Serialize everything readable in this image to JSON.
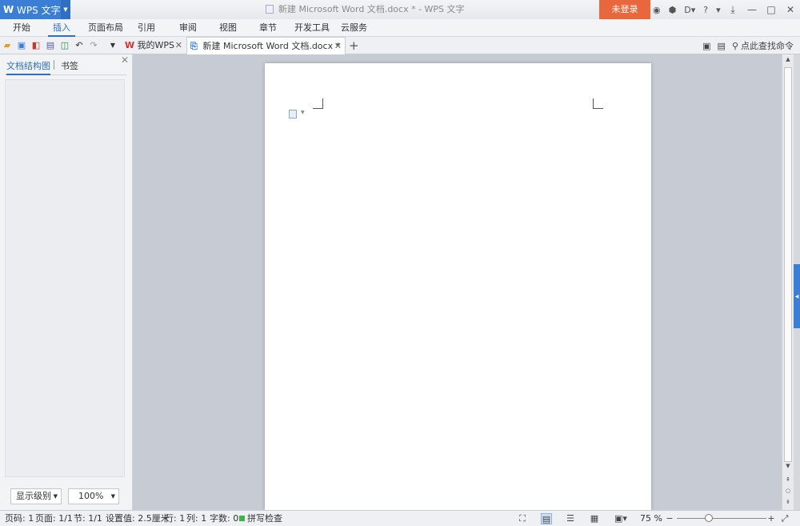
{
  "titlebar": {
    "app_name": "WPS 文字",
    "app_logo": "W",
    "document_title": "新建 Microsoft Word 文档.docx * - WPS 文字",
    "login_label": "未登录",
    "help_label": "?"
  },
  "menu": {
    "items": [
      "开始",
      "插入",
      "页面布局",
      "引用",
      "审阅",
      "视图",
      "章节",
      "开发工具",
      "云服务"
    ],
    "active": "插入"
  },
  "tabs": [
    {
      "label": "我的WPS",
      "icon": "wps-logo-icon"
    },
    {
      "label": "新建 Microsoft Word 文档.docx *",
      "icon": "document-icon",
      "active": true
    }
  ],
  "toolbar": {
    "search_command_label": "点此查找命令"
  },
  "left_pane": {
    "tabs": [
      "文档结构图",
      "书签"
    ],
    "active_tab": "文档结构图",
    "level_select": "显示级别",
    "zoom_select": "100%"
  },
  "statusbar": {
    "page_num": "页码: 1",
    "pages": "页面: 1/1",
    "section": "节: 1/1",
    "setting_value": "设置值: 2.5厘米",
    "row": "行: 1",
    "col": "列: 1",
    "word_count": "字数: 0",
    "spell_check": "拼写检查",
    "zoom_percent": "75 %"
  },
  "colors": {
    "accent": "#3a7fd5",
    "login": "#e8673c",
    "spellcheck": "#3bb54a"
  }
}
